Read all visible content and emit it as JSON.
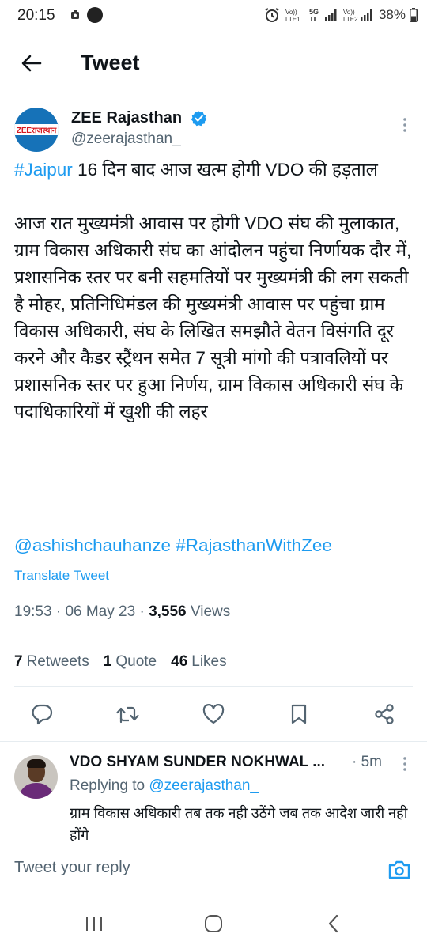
{
  "status_bar": {
    "time": "20:15",
    "battery": "38%"
  },
  "header": {
    "title": "Tweet",
    "back_icon": "arrow-left-icon"
  },
  "tweet": {
    "author": {
      "name": "ZEE Rajasthan",
      "handle": "@zeerajasthan_",
      "verified": true,
      "avatar_logo_text": "ZEEराजस्थान",
      "avatar_color": "#1672b8"
    },
    "hashtag": "#Jaipur",
    "headline_rest": "16 दिन बाद आज खत्म होगी VDO की हड़ताल",
    "paragraph": "आज रात मुख्यमंत्री आवास पर होगी VDO संघ की मुलाकात, ग्राम विकास अधिकारी संघ का आंदोलन पहुंचा निर्णायक दौर में, प्रशासनिक स्तर पर बनी सहमतियों पर मुख्यमंत्री की लग सकती है मोहर, प्रतिनिधिमंडल की मुख्यमंत्री आवास पर पहुंचा ग्राम विकास अधिकारी, संघ के लिखित समझौते वेतन विसंगति दूर करने और कैडर स्ट्रैंथन समेत 7 सूत्री मांगो की पत्रावलियों पर प्रशासनिक स्तर पर हुआ निर्णय, ग्राम विकास अधिकारी संघ के पदाधिकारियों में खुशी की लहर",
    "mention": "@ashishchauhanze",
    "tag": "#RajasthanWithZee",
    "translate_label": "Translate Tweet",
    "time": "19:53",
    "date": "06 May 23",
    "views_count": "3,556",
    "views_label": "Views",
    "retweets_count": "7",
    "retweets_label": "Retweets",
    "quotes_count": "1",
    "quotes_label": "Quote",
    "likes_count": "46",
    "likes_label": "Likes",
    "accent_color": "#1d9bf0"
  },
  "actions": [
    "reply-icon",
    "retweet-icon",
    "like-icon",
    "bookmark-icon",
    "share-icon"
  ],
  "reply": {
    "name": "VDO SHYAM SUNDER NOKHWAL ...",
    "time": "· 5m",
    "replying_prefix": "Replying to",
    "replying_handle": "@zeerajasthan_",
    "text": "ग्राम विकास अधिकारी तब तक नही उठेंगे जब तक आदेश जारी नही होंगे"
  },
  "compose": {
    "placeholder": "Tweet your reply",
    "camera_icon": "camera-icon"
  },
  "nav": [
    "recents-icon",
    "home-icon",
    "back-icon"
  ]
}
